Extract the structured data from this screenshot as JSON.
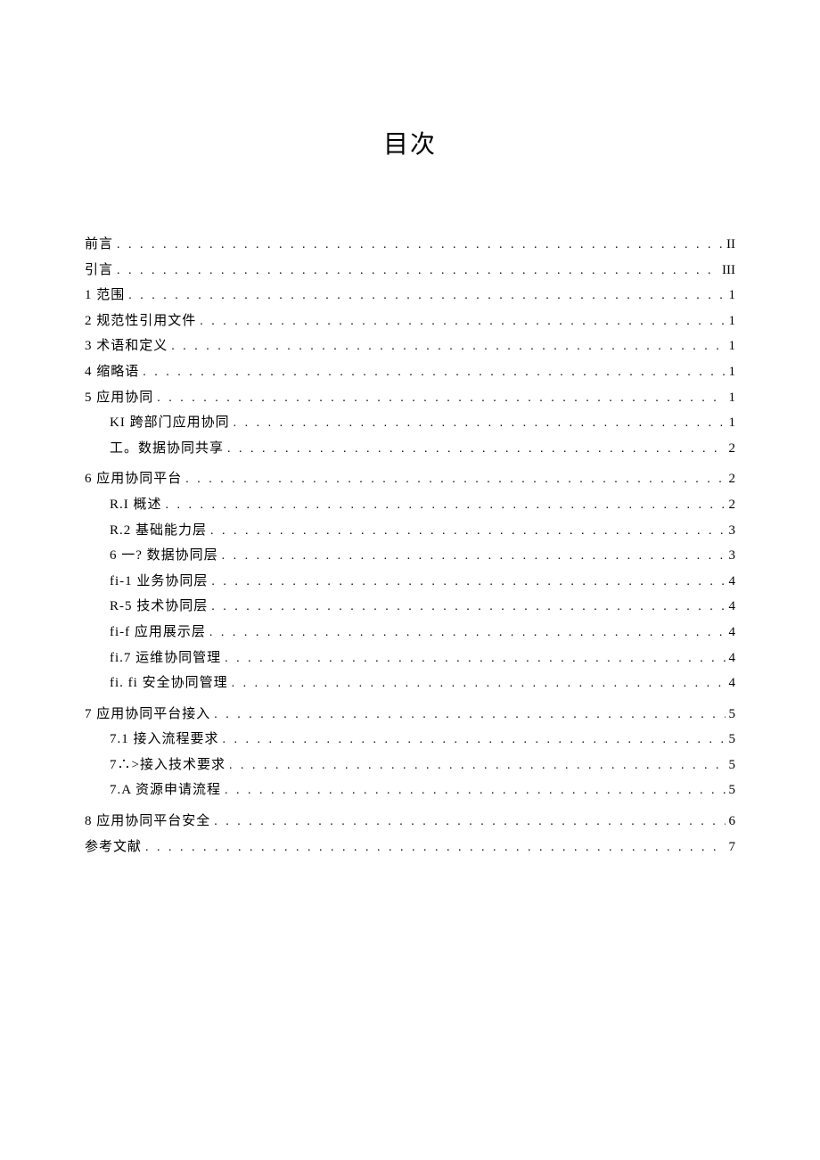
{
  "title": "目次",
  "entries": [
    {
      "level": 0,
      "label": "前言",
      "page": "II"
    },
    {
      "level": 0,
      "label": "引言",
      "page": "III"
    },
    {
      "level": 0,
      "label": "1 范围",
      "page": "1"
    },
    {
      "level": 0,
      "label": "2 规范性引用文件",
      "page": "1"
    },
    {
      "level": 0,
      "label": "3 术语和定义",
      "page": "1"
    },
    {
      "level": 0,
      "label": "4 缩略语",
      "page": "1"
    },
    {
      "level": 0,
      "label": "5 应用协同",
      "page": "1"
    },
    {
      "level": 1,
      "label": "KI 跨部门应用协同",
      "page": "1"
    },
    {
      "level": 1,
      "label": "工。数据协同共享",
      "page": "2"
    },
    {
      "level": 0,
      "label": "6 应用协同平台",
      "page": "2",
      "gap": true
    },
    {
      "level": 1,
      "label": "R.I 概述",
      "page": "2"
    },
    {
      "level": 1,
      "label": "R.2 基础能力层",
      "page": "3"
    },
    {
      "level": 1,
      "label": "6 一? 数据协同层",
      "page": "3"
    },
    {
      "level": 1,
      "label": "fi-1 业务协同层",
      "page": "4"
    },
    {
      "level": 1,
      "label": "R-5    技术协同层",
      "page": "4"
    },
    {
      "level": 1,
      "label": "fi-f     应用展示层",
      "page": "4"
    },
    {
      "level": 1,
      "label": "fi.7    运维协同管理",
      "page": "4"
    },
    {
      "level": 1,
      "label": "fi. fi 安全协同管理",
      "page": "4"
    },
    {
      "level": 0,
      "label": "7 应用协同平台接入",
      "page": "5",
      "gap": true
    },
    {
      "level": 1,
      "label": "7.1 接入流程要求",
      "page": "5"
    },
    {
      "level": 1,
      "label": "7∴>接入技术要求",
      "page": "5"
    },
    {
      "level": 1,
      "label": "7.A 资源申请流程",
      "page": "5"
    },
    {
      "level": 0,
      "label": "8 应用协同平台安全",
      "page": "6",
      "gap": true
    },
    {
      "level": 0,
      "label": "参考文献",
      "page": "7"
    }
  ]
}
